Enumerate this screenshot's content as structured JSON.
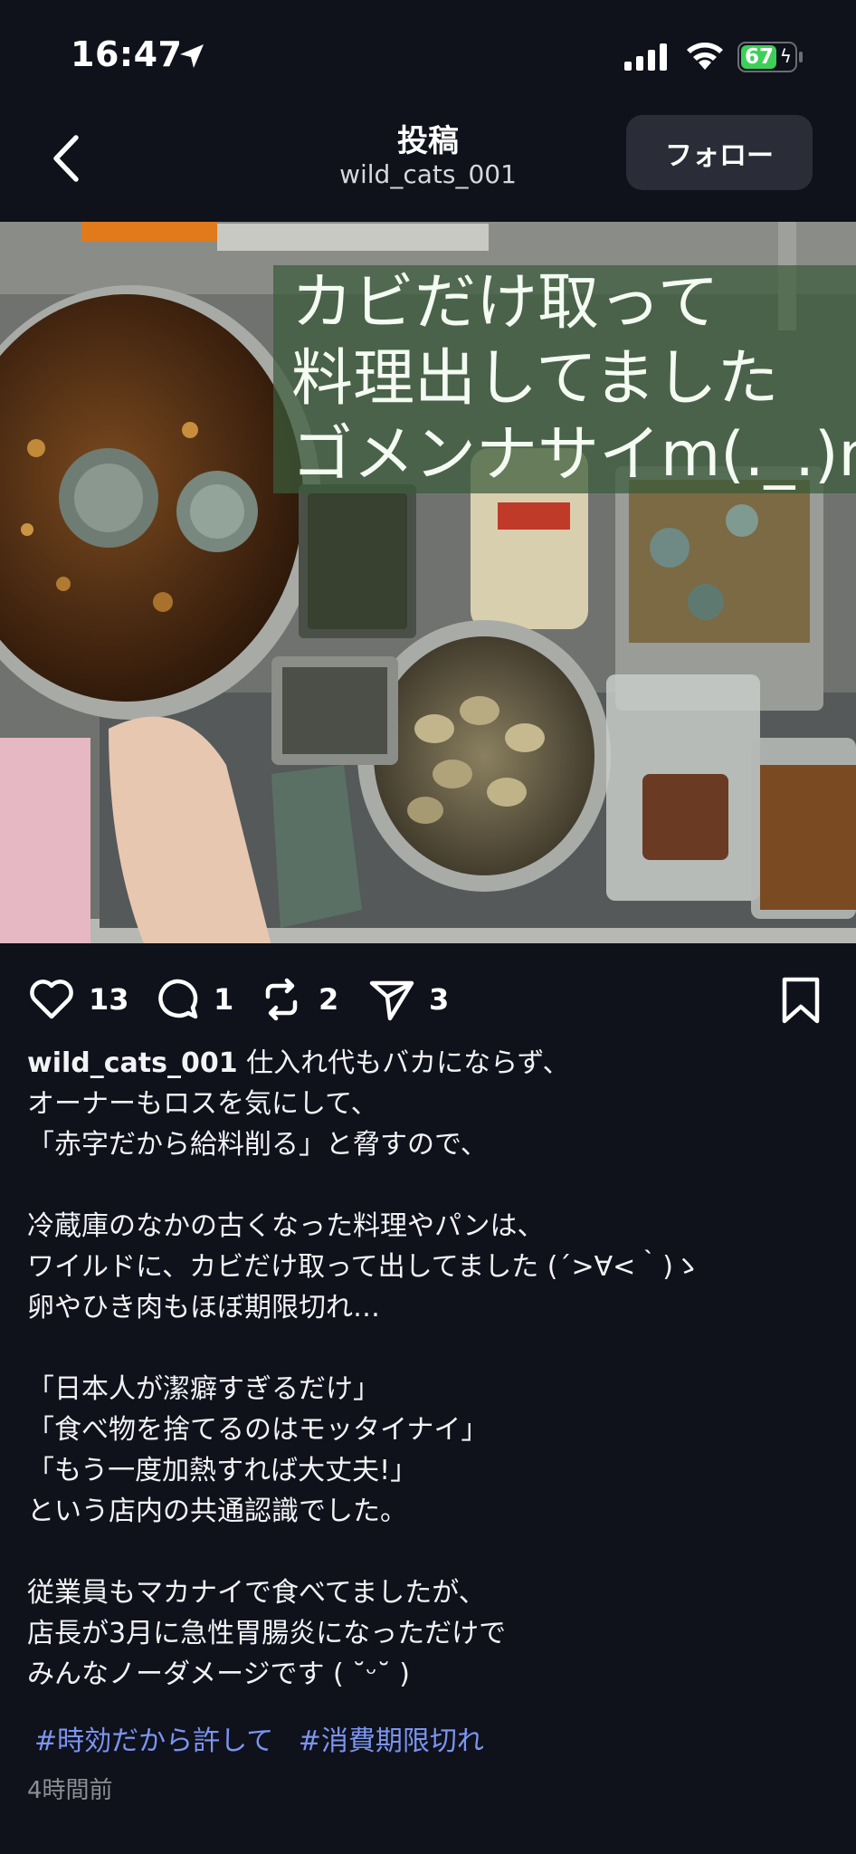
{
  "status_bar": {
    "time": "16:47",
    "battery": "67",
    "battery_level": 0.67,
    "icons": [
      "location-arrow-icon",
      "signal-icon",
      "wifi-icon",
      "battery-icon"
    ]
  },
  "header": {
    "title": "投稿",
    "subtitle": "wild_cats_001",
    "follow_label": "フォロー",
    "back_icon": "chevron-left-icon"
  },
  "photo": {
    "overlay_lines": [
      "カビだけ取って",
      "料理出してました",
      "ゴメンナサイm(._.)m"
    ]
  },
  "actions": {
    "like_count": "13",
    "comment_count": "1",
    "repost_count": "2",
    "share_count": "3",
    "icons": [
      "heart-icon",
      "comment-icon",
      "repost-icon",
      "share-icon",
      "bookmark-icon"
    ]
  },
  "caption": {
    "username": "wild_cats_001",
    "line1": " 仕入れ代もバカにならず、",
    "line2": "オーナーもロスを気にして、",
    "line3": "「赤字だから給料削る」と脅すので、",
    "line4": "冷蔵庫のなかの古くなった料理やパンは、",
    "line5": "ワイルドに、カビだけ取って出してました (´>∀<｀)ゝ",
    "line6": "卵やひき肉もほぼ期限切れ…",
    "line7": "「日本人が潔癖すぎるだけ」",
    "line8": "「食べ物を捨てるのはモッタイナイ」",
    "line9": "「もう一度加熱すれば大丈夫!」",
    "line10": "という店内の共通認識でした。",
    "line11": "従業員もマカナイで食べてましたが、",
    "line12": "店長が3月に急性胃腸炎になっただけで",
    "line13": "みんなノーダメージです ( ˘ᵕ˘ )"
  },
  "hashtags": [
    "#時効だから許して",
    "#消費期限切れ"
  ],
  "timestamp": "4時間前",
  "colors": {
    "background": "#0f111b",
    "hashtag": "#7b95f0",
    "follow_button_bg": "#2a2d37",
    "battery_green": "#3ecf58"
  }
}
